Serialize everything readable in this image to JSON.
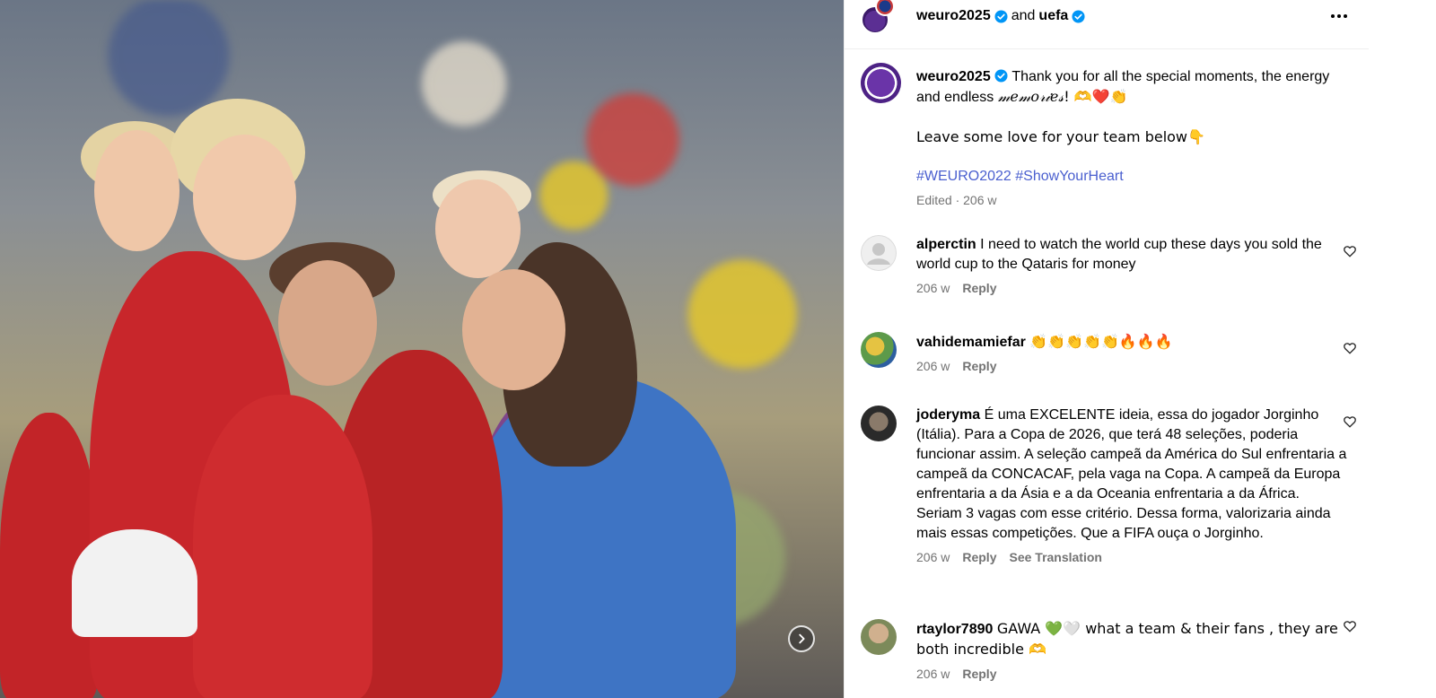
{
  "post": {
    "image_alt": "Players celebrating on the pitch",
    "next_icon": "chevron-right-icon"
  },
  "header": {
    "account1": "weuro2025",
    "joiner": "and",
    "account2": "uefa",
    "more_icon": "more-horizontal-icon"
  },
  "caption": {
    "username": "weuro2025",
    "text_part1": "Thank you for all the special moments, the energy and endless ",
    "styled_word": "𝓂𝑒𝓂𝑜𝓇𝒾𝑒𝓈",
    "text_part2": "! 🫶❤️👏",
    "line2": "Leave some love for your team below👇",
    "hashtags": "#WEURO2022 #ShowYourHeart",
    "meta": "Edited · 206 w"
  },
  "comments": [
    {
      "username": "alperctin",
      "text": "I need to watch the world cup these days you sold the world cup to the Qataris for money",
      "time": "206 w",
      "reply": "Reply",
      "avatar_color": "#dbdbdb"
    },
    {
      "username": "vahidemamiefar",
      "text": "👏👏👏👏👏🔥🔥🔥",
      "time": "206 w",
      "reply": "Reply",
      "avatar_color": "#8fb36b"
    },
    {
      "username": "joderyma",
      "text": "É uma EXCELENTE ideia, essa do jogador Jorginho (Itália). Para a Copa de 2026, que terá 48 seleções, poderia funcionar assim. A seleção campeã da América do Sul enfrentaria a campeã da CONCACAF, pela vaga na Copa. A campeã da Europa enfrentaria a da Ásia e a da Oceania enfrentaria a da África. Seriam 3 vagas com esse critério. Dessa forma, valorizaria ainda mais essas competições. Que a FIFA ouça o Jorginho.",
      "time": "206 w",
      "reply": "Reply",
      "translate": "See Translation",
      "avatar_color": "#3a3a3a"
    },
    {
      "username": "rtaylor7890",
      "text": "GAWA 💚🤍 what a team & their fans , they are both incredible 🫶",
      "time": "206 w",
      "reply": "Reply",
      "avatar_color": "#9c8a6a"
    }
  ],
  "colors": {
    "link": "#4a5fcf",
    "verified": "#0095f6",
    "muted": "#737373"
  }
}
